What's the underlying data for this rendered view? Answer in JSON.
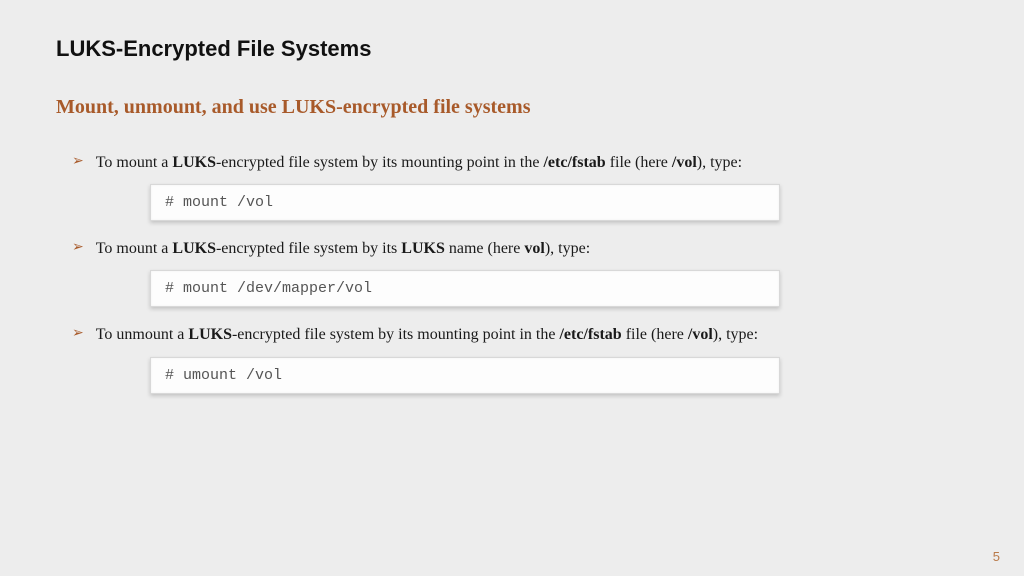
{
  "title": "LUKS-Encrypted File Systems",
  "section": "Mount, unmount, and use LUKS-encrypted file systems",
  "items": [
    {
      "pre": "To mount a ",
      "b1": "LUKS",
      "mid1": "-encrypted file system by its mounting point in the ",
      "b2": "/etc/fstab",
      "mid2": " file (here ",
      "b3": "/vol",
      "post": "), type:",
      "code": "# mount /vol"
    },
    {
      "pre": "To mount a ",
      "b1": "LUKS",
      "mid1": "-encrypted file system by its ",
      "b2": "LUKS",
      "mid2": " name (here ",
      "b3": "vol",
      "post": "), type:",
      "code": "# mount /dev/mapper/vol"
    },
    {
      "pre": "To unmount a ",
      "b1": "LUKS",
      "mid1": "-encrypted file system by its mounting point in the ",
      "b2": "/etc/fstab",
      "mid2": " file (here ",
      "b3": "/vol",
      "post": "), type:",
      "code": "# umount /vol"
    }
  ],
  "pageNumber": "5"
}
